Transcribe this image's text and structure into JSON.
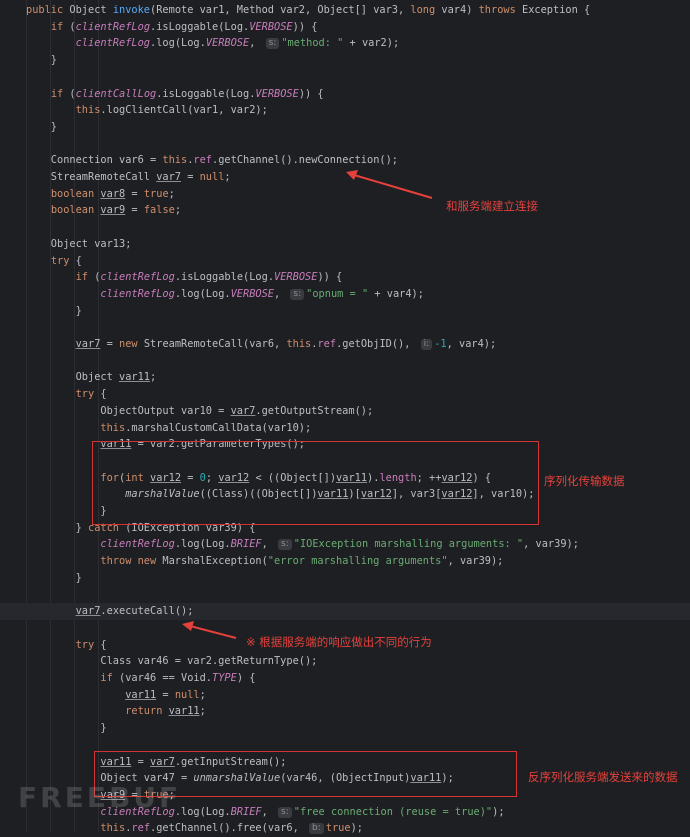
{
  "code": {
    "line_height": 16.7,
    "current_line_index": 36,
    "lines": [
      [
        [
          "kw",
          "public "
        ],
        [
          "cls",
          "Object "
        ],
        [
          "fn",
          "invoke"
        ],
        [
          "cls",
          "(Remote var1, Method var2, Object[] var3, "
        ],
        [
          "kw",
          "long "
        ],
        [
          "cls",
          "var4) "
        ],
        [
          "kw",
          "throws "
        ],
        [
          "cls",
          "Exception {"
        ]
      ],
      [
        [
          "cls",
          "    "
        ],
        [
          "kw",
          "if "
        ],
        [
          "cls",
          "("
        ],
        [
          "fld ital",
          "clientRefLog"
        ],
        [
          "cls",
          "."
        ],
        [
          "cls",
          "isLoggable(Log."
        ],
        [
          "fld ital",
          "VERBOSE"
        ],
        [
          "cls",
          ")) {"
        ]
      ],
      [
        [
          "cls",
          "        "
        ],
        [
          "fld ital",
          "clientRefLog"
        ],
        [
          "cls",
          ".log(Log."
        ],
        [
          "fld ital",
          "VERBOSE"
        ],
        [
          "cls",
          ", "
        ],
        [
          "hint",
          "s:"
        ],
        [
          "str",
          "\"method: \""
        ],
        [
          "cls",
          " + var2);"
        ]
      ],
      [
        [
          "cls",
          "    }"
        ]
      ],
      [],
      [
        [
          "cls",
          "    "
        ],
        [
          "kw",
          "if "
        ],
        [
          "cls",
          "("
        ],
        [
          "fld ital",
          "clientCallLog"
        ],
        [
          "cls",
          ".isLoggable(Log."
        ],
        [
          "fld ital",
          "VERBOSE"
        ],
        [
          "cls",
          ")) {"
        ]
      ],
      [
        [
          "cls",
          "        "
        ],
        [
          "kw",
          "this"
        ],
        [
          "cls",
          ".logClientCall(var1, var2);"
        ]
      ],
      [
        [
          "cls",
          "    }"
        ]
      ],
      [],
      [
        [
          "cls",
          "    Connection var6 = "
        ],
        [
          "kw",
          "this"
        ],
        [
          "cls",
          "."
        ],
        [
          "fld",
          "ref"
        ],
        [
          "cls",
          ".getChannel().newConnection();"
        ]
      ],
      [
        [
          "cls",
          "    StreamRemoteCall "
        ],
        [
          "var-u",
          "var7"
        ],
        [
          "cls",
          " = "
        ],
        [
          "kw",
          "null"
        ],
        [
          "cls",
          ";"
        ]
      ],
      [
        [
          "cls",
          "    "
        ],
        [
          "kw",
          "boolean "
        ],
        [
          "var-u",
          "var8"
        ],
        [
          "cls",
          " = "
        ],
        [
          "kw",
          "true"
        ],
        [
          "cls",
          ";"
        ]
      ],
      [
        [
          "cls",
          "    "
        ],
        [
          "kw",
          "boolean "
        ],
        [
          "var-u",
          "var9"
        ],
        [
          "cls",
          " = "
        ],
        [
          "kw",
          "false"
        ],
        [
          "cls",
          ";"
        ]
      ],
      [],
      [
        [
          "cls",
          "    Object var13;"
        ]
      ],
      [
        [
          "cls",
          "    "
        ],
        [
          "kw",
          "try "
        ],
        [
          "cls",
          "{"
        ]
      ],
      [
        [
          "cls",
          "        "
        ],
        [
          "kw",
          "if "
        ],
        [
          "cls",
          "("
        ],
        [
          "fld ital",
          "clientRefLog"
        ],
        [
          "cls",
          ".isLoggable(Log."
        ],
        [
          "fld ital",
          "VERBOSE"
        ],
        [
          "cls",
          ")) {"
        ]
      ],
      [
        [
          "cls",
          "            "
        ],
        [
          "fld ital",
          "clientRefLog"
        ],
        [
          "cls",
          ".log(Log."
        ],
        [
          "fld ital",
          "VERBOSE"
        ],
        [
          "cls",
          ", "
        ],
        [
          "hint",
          "s:"
        ],
        [
          "str",
          "\"opnum = \""
        ],
        [
          "cls",
          " + var4);"
        ]
      ],
      [
        [
          "cls",
          "        }"
        ]
      ],
      [],
      [
        [
          "cls",
          "        "
        ],
        [
          "var-u",
          "var7"
        ],
        [
          "cls",
          " = "
        ],
        [
          "kw",
          "new "
        ],
        [
          "cls",
          "StreamRemoteCall(var6, "
        ],
        [
          "kw",
          "this"
        ],
        [
          "cls",
          "."
        ],
        [
          "fld",
          "ref"
        ],
        [
          "cls",
          ".getObjID(), "
        ],
        [
          "hint",
          "i:"
        ],
        [
          "num",
          "-1"
        ],
        [
          "cls",
          ", var4);"
        ]
      ],
      [],
      [
        [
          "cls",
          "        Object "
        ],
        [
          "var-u",
          "var11"
        ],
        [
          "cls",
          ";"
        ]
      ],
      [
        [
          "cls",
          "        "
        ],
        [
          "kw",
          "try "
        ],
        [
          "cls",
          "{"
        ]
      ],
      [
        [
          "cls",
          "            ObjectOutput var10 = "
        ],
        [
          "var-u",
          "var7"
        ],
        [
          "cls",
          ".getOutputStream();"
        ]
      ],
      [
        [
          "cls",
          "            "
        ],
        [
          "kw",
          "this"
        ],
        [
          "cls",
          ".marshalCustomCallData(var10);"
        ]
      ],
      [
        [
          "cls",
          "            "
        ],
        [
          "var-u",
          "var11"
        ],
        [
          "cls",
          " = var2.getParameterTypes();"
        ]
      ],
      [],
      [
        [
          "cls",
          "            "
        ],
        [
          "kw",
          "for"
        ],
        [
          "cls",
          "("
        ],
        [
          "kw",
          "int "
        ],
        [
          "var-u",
          "var12"
        ],
        [
          "cls",
          " = "
        ],
        [
          "num",
          "0"
        ],
        [
          "cls",
          "; "
        ],
        [
          "var-u",
          "var12"
        ],
        [
          "cls",
          " < ((Object[])"
        ],
        [
          "var-u",
          "var11"
        ],
        [
          "cls",
          ")."
        ],
        [
          "fld",
          "length"
        ],
        [
          "cls",
          "; ++"
        ],
        [
          "var-u",
          "var12"
        ],
        [
          "cls",
          ") {"
        ]
      ],
      [
        [
          "cls",
          "                "
        ],
        [
          "ital",
          "marshalValue"
        ],
        [
          "cls",
          "((Class)((Object[])"
        ],
        [
          "var-u",
          "var11"
        ],
        [
          "cls",
          ")["
        ],
        [
          "var-u",
          "var12"
        ],
        [
          "cls",
          "], var3["
        ],
        [
          "var-u",
          "var12"
        ],
        [
          "cls",
          "], var10);"
        ]
      ],
      [
        [
          "cls",
          "            }"
        ]
      ],
      [
        [
          "cls",
          "        } "
        ],
        [
          "kw",
          "catch "
        ],
        [
          "cls",
          "(IOException var39) {"
        ]
      ],
      [
        [
          "cls",
          "            "
        ],
        [
          "fld ital",
          "clientRefLog"
        ],
        [
          "cls",
          ".log(Log."
        ],
        [
          "fld ital",
          "BRIEF"
        ],
        [
          "cls",
          ", "
        ],
        [
          "hint",
          "s:"
        ],
        [
          "str",
          "\"IOException marshalling arguments: \""
        ],
        [
          "cls",
          ", var39);"
        ]
      ],
      [
        [
          "cls",
          "            "
        ],
        [
          "kw",
          "throw new "
        ],
        [
          "cls",
          "MarshalException("
        ],
        [
          "str",
          "\"error marshalling arguments\""
        ],
        [
          "cls",
          ", var39);"
        ]
      ],
      [
        [
          "cls",
          "        }"
        ]
      ],
      [],
      [
        [
          "cls",
          "        "
        ],
        [
          "var-u",
          "var7"
        ],
        [
          "cls",
          ".executeCall();"
        ]
      ],
      [],
      [
        [
          "cls",
          "        "
        ],
        [
          "kw",
          "try "
        ],
        [
          "cls",
          "{"
        ]
      ],
      [
        [
          "cls",
          "            Class var46 = var2.getReturnType();"
        ]
      ],
      [
        [
          "cls",
          "            "
        ],
        [
          "kw",
          "if "
        ],
        [
          "cls",
          "(var46 == Void."
        ],
        [
          "fld ital",
          "TYPE"
        ],
        [
          "cls",
          ") {"
        ]
      ],
      [
        [
          "cls",
          "                "
        ],
        [
          "var-u",
          "var11"
        ],
        [
          "cls",
          " = "
        ],
        [
          "kw",
          "null"
        ],
        [
          "cls",
          ";"
        ]
      ],
      [
        [
          "cls",
          "                "
        ],
        [
          "kw",
          "return "
        ],
        [
          "var-u",
          "var11"
        ],
        [
          "cls",
          ";"
        ]
      ],
      [
        [
          "cls",
          "            }"
        ]
      ],
      [],
      [
        [
          "cls",
          "            "
        ],
        [
          "var-u",
          "var11"
        ],
        [
          "cls",
          " = "
        ],
        [
          "var-u",
          "var7"
        ],
        [
          "cls",
          ".getInputStream();"
        ]
      ],
      [
        [
          "cls",
          "            Object var47 = "
        ],
        [
          "ital",
          "unmarshalValue"
        ],
        [
          "cls",
          "(var46, (ObjectInput)"
        ],
        [
          "var-u",
          "var11"
        ],
        [
          "cls",
          ");"
        ]
      ],
      [
        [
          "cls",
          "            "
        ],
        [
          "var-u",
          "var9"
        ],
        [
          "cls",
          " = "
        ],
        [
          "kw",
          "true"
        ],
        [
          "cls",
          ";"
        ]
      ],
      [
        [
          "cls",
          "            "
        ],
        [
          "fld ital",
          "clientRefLog"
        ],
        [
          "cls",
          ".log(Log."
        ],
        [
          "fld ital",
          "BRIEF"
        ],
        [
          "cls",
          ", "
        ],
        [
          "hint",
          "s:"
        ],
        [
          "str",
          "\"free connection (reuse = true)\""
        ],
        [
          "cls",
          ");"
        ]
      ],
      [
        [
          "cls",
          "            "
        ],
        [
          "kw",
          "this"
        ],
        [
          "cls",
          "."
        ],
        [
          "fld",
          "ref"
        ],
        [
          "cls",
          ".getChannel().free(var6, "
        ],
        [
          "hint",
          "b:"
        ],
        [
          "kw",
          "true"
        ],
        [
          "cls",
          ");"
        ]
      ]
    ]
  },
  "annotations": {
    "connect": "和服务端建立连接",
    "serialize": "序列化传输数据",
    "response": "※ 根据服务端的响应做出不同的行为",
    "deserialize": "反序列化服务端发送来的数据"
  },
  "watermark": "FREEBUF",
  "colors": {
    "annotation": "#e5413c",
    "background": "#1e1f22"
  }
}
